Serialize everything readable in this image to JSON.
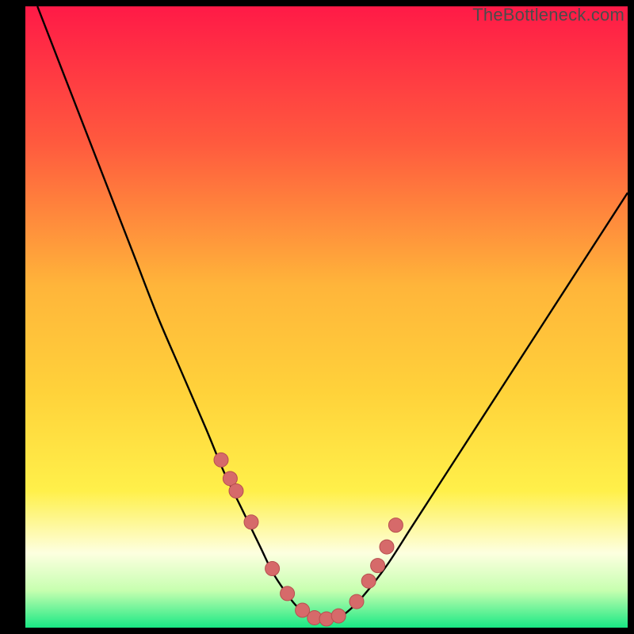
{
  "watermark": "TheBottleneck.com",
  "colors": {
    "bg_black": "#000000",
    "curve": "#000000",
    "marker_fill": "#d66a6a",
    "marker_stroke": "#b84f4f",
    "grad_top": "#ff1a47",
    "grad_mid1": "#ff6a3a",
    "grad_mid2": "#ffd23a",
    "grad_mid3": "#fff04a",
    "grad_low_pale": "#fdffe0",
    "grad_bottom": "#19e884"
  },
  "chart_data": {
    "type": "line",
    "title": "",
    "xlabel": "",
    "ylabel": "",
    "xlim": [
      0,
      100
    ],
    "ylim": [
      0,
      100
    ],
    "series": [
      {
        "name": "bottleneck-curve",
        "x": [
          2,
          6,
          10,
          14,
          18,
          22,
          26,
          30,
          33,
          36,
          39,
          41,
          43,
          45,
          47,
          49,
          51,
          53,
          56,
          60,
          64,
          68,
          72,
          76,
          80,
          84,
          88,
          92,
          96,
          100
        ],
        "y": [
          100,
          90,
          80,
          70,
          60,
          50,
          41,
          32,
          25,
          19,
          13,
          9,
          6,
          3.5,
          2,
          1.4,
          1.4,
          2.2,
          5,
          10,
          16,
          22,
          28,
          34,
          40,
          46,
          52,
          58,
          64,
          70
        ]
      }
    ],
    "markers": {
      "name": "highlight-points",
      "x": [
        32.5,
        34,
        35,
        37.5,
        41,
        43.5,
        46,
        48,
        50,
        52,
        55,
        57,
        58.5,
        60,
        61.5
      ],
      "y": [
        27,
        24,
        22,
        17,
        9.5,
        5.5,
        2.8,
        1.6,
        1.4,
        1.9,
        4.2,
        7.5,
        10,
        13,
        16.5
      ]
    }
  }
}
